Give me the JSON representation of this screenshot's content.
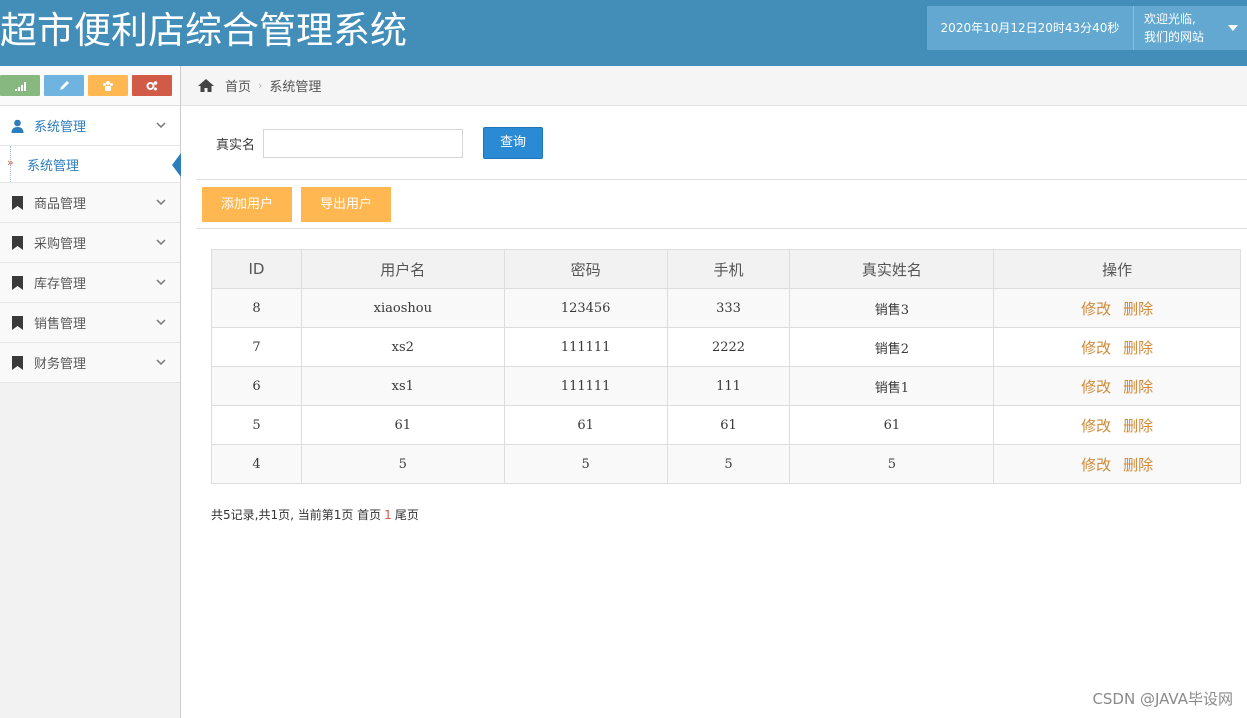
{
  "app": {
    "title": "超市便利店综合管理系统"
  },
  "header": {
    "datetime": "2020年10月12日20时43分40秒",
    "welcome_line1": "欢迎光临,",
    "welcome_line2": "我们的网站"
  },
  "shortcuts": [
    {
      "icon": "signal-icon",
      "color": "#87b87f"
    },
    {
      "icon": "pencil-icon",
      "color": "#6fb3e0"
    },
    {
      "icon": "group-icon",
      "color": "#ffb752"
    },
    {
      "icon": "cogs-icon",
      "color": "#d15b47"
    }
  ],
  "sidebar": {
    "items": [
      {
        "label": "系统管理",
        "icon": "user-icon",
        "expanded": true,
        "sub": [
          {
            "label": "系统管理"
          }
        ]
      },
      {
        "label": "商品管理",
        "icon": "bookmark-icon"
      },
      {
        "label": "采购管理",
        "icon": "bookmark-icon"
      },
      {
        "label": "库存管理",
        "icon": "bookmark-icon"
      },
      {
        "label": "销售管理",
        "icon": "bookmark-icon"
      },
      {
        "label": "财务管理",
        "icon": "bookmark-icon"
      }
    ]
  },
  "breadcrumb": {
    "home": "首页",
    "current": "系统管理"
  },
  "search": {
    "label": "真实名",
    "value": "",
    "button": "查询"
  },
  "toolbar": {
    "add": "添加用户",
    "export": "导出用户"
  },
  "table": {
    "columns": [
      "ID",
      "用户名",
      "密码",
      "手机",
      "真实姓名",
      "操作"
    ],
    "rows": [
      [
        "8",
        "xiaoshou",
        "123456",
        "333",
        "销售3"
      ],
      [
        "7",
        "xs2",
        "111111",
        "2222",
        "销售2"
      ],
      [
        "6",
        "xs1",
        "111111",
        "111",
        "销售1"
      ],
      [
        "5",
        "61",
        "61",
        "61",
        "61"
      ],
      [
        "4",
        "5",
        "5",
        "5",
        "5"
      ]
    ],
    "edit_label": "修改",
    "delete_label": "删除"
  },
  "pager": {
    "prefix": "共5记录,共1页, 当前第1页 首页",
    "current": "1",
    "suffix": "尾页"
  },
  "watermark": "CSDN @JAVA毕设网"
}
